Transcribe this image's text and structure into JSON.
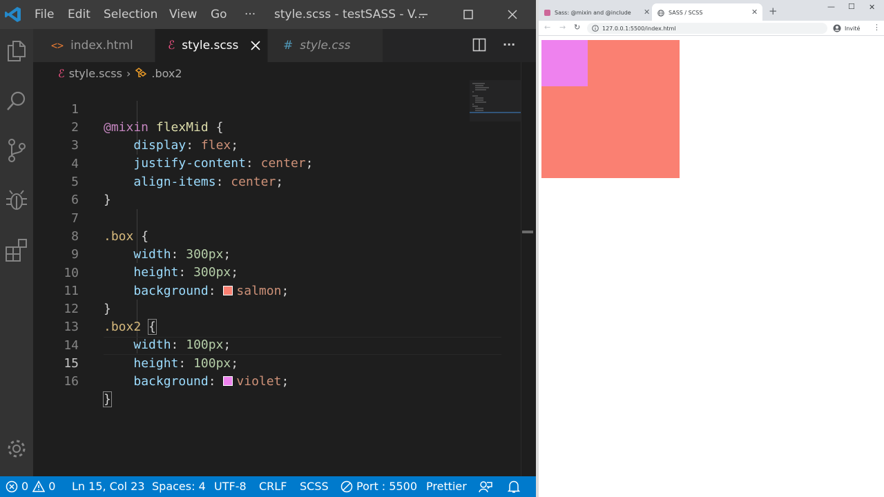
{
  "vscode": {
    "menu": [
      "File",
      "Edit",
      "Selection",
      "View",
      "Go",
      "···"
    ],
    "window_title": "style.scss - testSASS - V...",
    "tabs": [
      {
        "label": "index.html",
        "icon": "html-file-icon",
        "state": "inactive"
      },
      {
        "label": "style.scss",
        "icon": "sass-file-icon",
        "state": "active"
      },
      {
        "label": "style.css",
        "icon": "css-file-icon",
        "state": "inactive-italic"
      }
    ],
    "breadcrumb": {
      "file": "style.scss",
      "symbol": ".box2"
    },
    "code": {
      "l1": {
        "num": "1",
        "kw": "@mixin",
        "name": "flexMid",
        "brace": "{"
      },
      "l2": {
        "num": "2",
        "prop": "display",
        "val": "flex"
      },
      "l3": {
        "num": "3",
        "prop": "justify-content",
        "val": "center"
      },
      "l4": {
        "num": "4",
        "prop": "align-items",
        "val": "center"
      },
      "l5": {
        "num": "5",
        "brace": "}"
      },
      "l6": {
        "num": "6"
      },
      "l7": {
        "num": "7",
        "sel": ".box",
        "brace": "{"
      },
      "l8": {
        "num": "8",
        "prop": "width",
        "val": "300px"
      },
      "l9": {
        "num": "9",
        "prop": "height",
        "val": "300px"
      },
      "l10": {
        "num": "10",
        "prop": "background",
        "val": "salmon",
        "swatch": "#fa8072"
      },
      "l11": {
        "num": "11",
        "brace": "}"
      },
      "l12": {
        "num": "12",
        "sel": ".box2",
        "brace": "{"
      },
      "l13": {
        "num": "13",
        "prop": "width",
        "val": "100px"
      },
      "l14": {
        "num": "14",
        "prop": "height",
        "val": "100px"
      },
      "l15": {
        "num": "15",
        "prop": "background",
        "val": "violet",
        "swatch": "#ee82ee"
      },
      "l16": {
        "num": "16",
        "brace": "}"
      }
    },
    "status": {
      "errors": "0",
      "warnings": "0",
      "cursor": "Ln 15, Col 23",
      "spaces": "Spaces: 4",
      "encoding": "UTF-8",
      "eol": "CRLF",
      "language": "SCSS",
      "port": "Port : 5500",
      "formatter": "Prettier"
    },
    "colors": {
      "accent": "#007acc",
      "titlebar": "#3c3c3c",
      "editor_bg": "#1e1e1e"
    }
  },
  "browser": {
    "tabs": [
      {
        "title": "Sass: @mixin and @include",
        "favicon_color": "#cd6799",
        "active": false
      },
      {
        "title": "SASS / SCSS",
        "favicon": "globe-icon",
        "active": true
      }
    ],
    "url": "127.0.0.1:5500/index.html",
    "profile_label": "Invité",
    "page": {
      "box_color": "#fa8072",
      "box2_color": "#ee82ee"
    }
  }
}
